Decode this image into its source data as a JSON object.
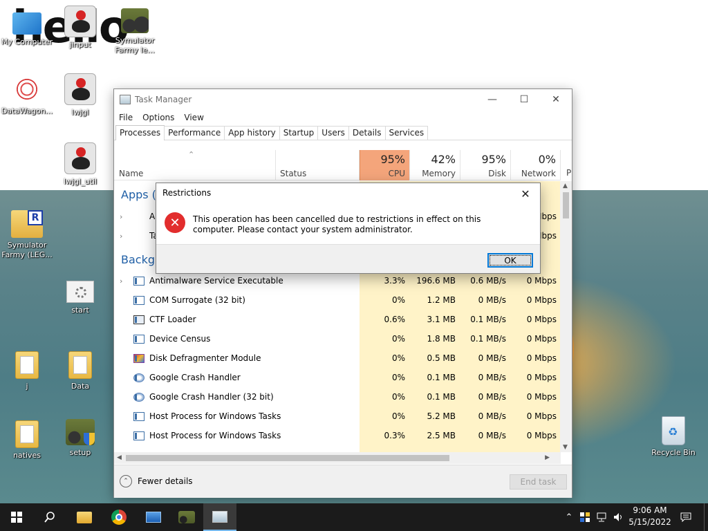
{
  "desktop": {
    "wallpaper_text": "hello",
    "icons": [
      {
        "label": "My Computer"
      },
      {
        "label": "jinput"
      },
      {
        "label": "Symulator Farmy le..."
      },
      {
        "label": "DataWagon..."
      },
      {
        "label": "lwjgl"
      },
      {
        "label": "lwjgl_util"
      },
      {
        "label": "Symulator Farmy (LEG..."
      },
      {
        "label": "start"
      },
      {
        "label": "j"
      },
      {
        "label": "Data"
      },
      {
        "label": "natives"
      },
      {
        "label": "setup"
      },
      {
        "label": "Recycle Bin"
      }
    ]
  },
  "task_manager": {
    "title": "Task Manager",
    "menu": [
      "File",
      "Options",
      "View"
    ],
    "tabs": [
      "Processes",
      "Performance",
      "App history",
      "Startup",
      "Users",
      "Details",
      "Services"
    ],
    "columns": {
      "name": "Name",
      "status": "Status",
      "cpu": {
        "pct": "95%",
        "label": "CPU"
      },
      "memory": {
        "pct": "42%",
        "label": "Memory"
      },
      "disk": {
        "pct": "95%",
        "label": "Disk"
      },
      "network": {
        "pct": "0%",
        "label": "Network"
      },
      "power_partial": "P"
    },
    "sections": {
      "apps": "Apps (2",
      "background": "Backgro"
    },
    "app_rows": [
      {
        "name": "A",
        "net": "Mbps"
      },
      {
        "name": "Ta",
        "net": "Mbps"
      }
    ],
    "rows": [
      {
        "name": "Antimalware Service Executable",
        "cpu": "3.3%",
        "memory": "196.6 MB",
        "disk": "0.6 MB/s",
        "network": "0 Mbps",
        "expand": true
      },
      {
        "name": "COM Surrogate (32 bit)",
        "cpu": "0%",
        "memory": "1.2 MB",
        "disk": "0 MB/s",
        "network": "0 Mbps"
      },
      {
        "name": "CTF Loader",
        "cpu": "0.6%",
        "memory": "3.1 MB",
        "disk": "0.1 MB/s",
        "network": "0 Mbps"
      },
      {
        "name": "Device Census",
        "cpu": "0%",
        "memory": "1.8 MB",
        "disk": "0.1 MB/s",
        "network": "0 Mbps"
      },
      {
        "name": "Disk Defragmenter Module",
        "cpu": "0%",
        "memory": "0.5 MB",
        "disk": "0 MB/s",
        "network": "0 Mbps"
      },
      {
        "name": "Google Crash Handler",
        "cpu": "0%",
        "memory": "0.1 MB",
        "disk": "0 MB/s",
        "network": "0 Mbps"
      },
      {
        "name": "Google Crash Handler (32 bit)",
        "cpu": "0%",
        "memory": "0.1 MB",
        "disk": "0 MB/s",
        "network": "0 Mbps"
      },
      {
        "name": "Host Process for Windows Tasks",
        "cpu": "0%",
        "memory": "5.2 MB",
        "disk": "0 MB/s",
        "network": "0 Mbps"
      },
      {
        "name": "Host Process for Windows Tasks",
        "cpu": "0.3%",
        "memory": "2.5 MB",
        "disk": "0 MB/s",
        "network": "0 Mbps"
      }
    ],
    "footer": {
      "fewer_details": "Fewer details",
      "end_task": "End task"
    }
  },
  "dialog": {
    "title": "Restrictions",
    "message": "This operation has been cancelled due to restrictions in effect on this computer. Please contact your system administrator.",
    "ok": "OK",
    "error_glyph": "✕"
  },
  "taskbar": {
    "time": "9:06 AM",
    "date": "5/15/2022"
  },
  "colors": {
    "cpu_header": "#f4a57b",
    "heat_cell": "#fff3c8",
    "section_header": "#1f5fa6",
    "taskbar": "#1b1b1b",
    "ok_focus": "#0078d7"
  }
}
